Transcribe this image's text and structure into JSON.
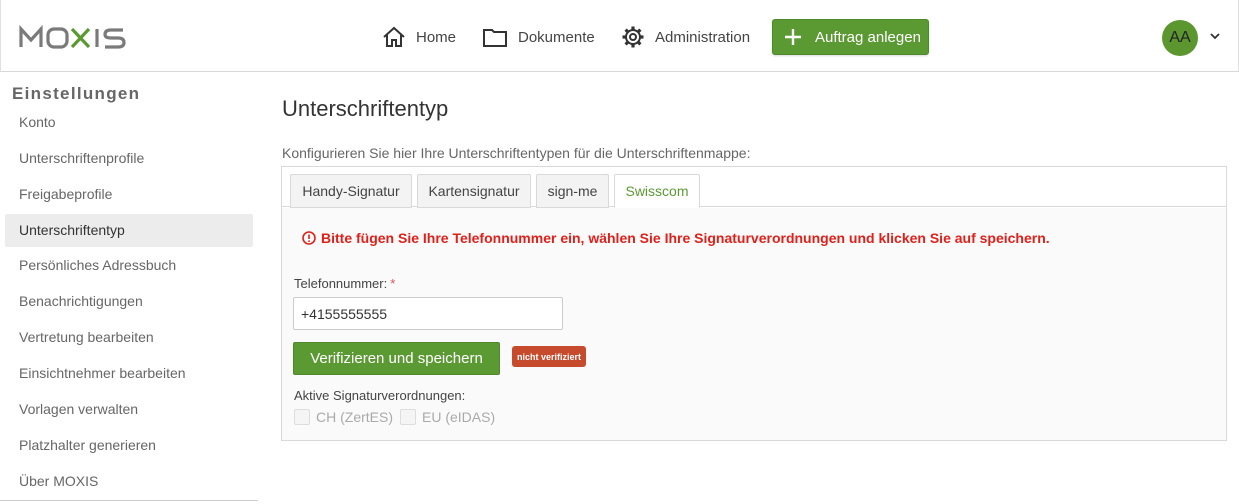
{
  "header": {
    "logo_text": "MOXIS",
    "nav": [
      {
        "label": "Home",
        "icon": "home-icon"
      },
      {
        "label": "Dokumente",
        "icon": "folder-icon"
      },
      {
        "label": "Administration",
        "icon": "gear-icon"
      }
    ],
    "new_order_label": "Auftrag anlegen",
    "user_initials": "AA"
  },
  "sidebar": {
    "title": "Einstellungen",
    "items": [
      {
        "label": "Konto"
      },
      {
        "label": "Unterschriftenprofile"
      },
      {
        "label": "Freigabeprofile"
      },
      {
        "label": "Unterschriftentyp",
        "active": true
      },
      {
        "label": "Persönliches Adressbuch"
      },
      {
        "label": "Benachrichtigungen"
      },
      {
        "label": "Vertretung bearbeiten"
      },
      {
        "label": "Einsichtnehmer bearbeiten"
      },
      {
        "label": "Vorlagen verwalten"
      },
      {
        "label": "Platzhalter generieren"
      },
      {
        "label": "Über MOXIS"
      }
    ]
  },
  "main": {
    "title": "Unterschriftentyp",
    "description": "Konfigurieren Sie hier Ihre Unterschriftentypen für die Unterschriftenmappe:",
    "tabs": [
      {
        "label": "Handy-Signatur"
      },
      {
        "label": "Kartensignatur"
      },
      {
        "label": "sign-me"
      },
      {
        "label": "Swisscom",
        "active": true
      }
    ],
    "error_message": "Bitte fügen Sie Ihre Telefonnummer ein, wählen Sie Ihre Signaturverordnungen und klicken Sie auf speichern.",
    "phone_label": "Telefonnummer:",
    "required_marker": "*",
    "phone_value": "+4155555555",
    "verify_button_label": "Verifizieren und speichern",
    "status_badge": "nicht verifiziert",
    "regulations_label": "Aktive Signaturverordnungen:",
    "regulations": [
      {
        "label": "CH (ZertES)",
        "checked": false,
        "disabled": true
      },
      {
        "label": "EU (eIDAS)",
        "checked": false,
        "disabled": true
      }
    ]
  },
  "colors": {
    "accent": "#5b9a33",
    "error": "#e0201a",
    "badge": "#c64a2c"
  }
}
